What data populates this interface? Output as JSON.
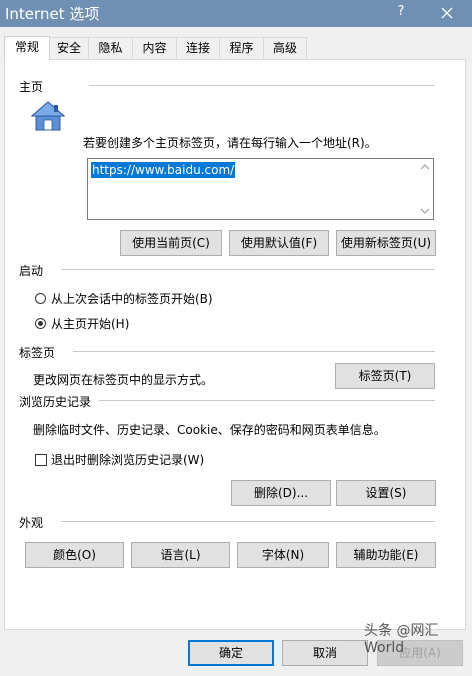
{
  "window": {
    "title": "Internet 选项",
    "help": "?",
    "close": "✕"
  },
  "tabs": [
    {
      "label": "常规",
      "active": true
    },
    {
      "label": "安全"
    },
    {
      "label": "隐私"
    },
    {
      "label": "内容"
    },
    {
      "label": "连接"
    },
    {
      "label": "程序"
    },
    {
      "label": "高级"
    }
  ],
  "homepage": {
    "section_label": "主页",
    "hint": "若要创建多个主页标签页，请在每行输入一个地址(R)。",
    "url": "https://www.baidu.com/",
    "buttons": {
      "current": "使用当前页(C)",
      "default": "使用默认值(F)",
      "new_tab": "使用新标签页(U)"
    }
  },
  "startup": {
    "section_label": "启动",
    "option1": "从上次会话中的标签页开始(B)",
    "option2": "从主页开始(H)",
    "selected": "option2"
  },
  "tabsection": {
    "section_label": "标签页",
    "description": "更改网页在标签页中的显示方式。",
    "button": "标签页(T)"
  },
  "history": {
    "section_label": "浏览历史记录",
    "description": "删除临时文件、历史记录、Cookie、保存的密码和网页表单信息。",
    "checkbox": "退出时删除浏览历史记录(W)",
    "checked": false,
    "delete_button": "删除(D)...",
    "settings_button": "设置(S)"
  },
  "appearance": {
    "section_label": "外观",
    "colors": "颜色(O)",
    "languages": "语言(L)",
    "fonts": "字体(N)",
    "accessibility": "辅助功能(E)"
  },
  "footer": {
    "ok": "确定",
    "cancel": "取消",
    "apply": "应用(A)"
  },
  "watermark": "头条 @网汇World"
}
